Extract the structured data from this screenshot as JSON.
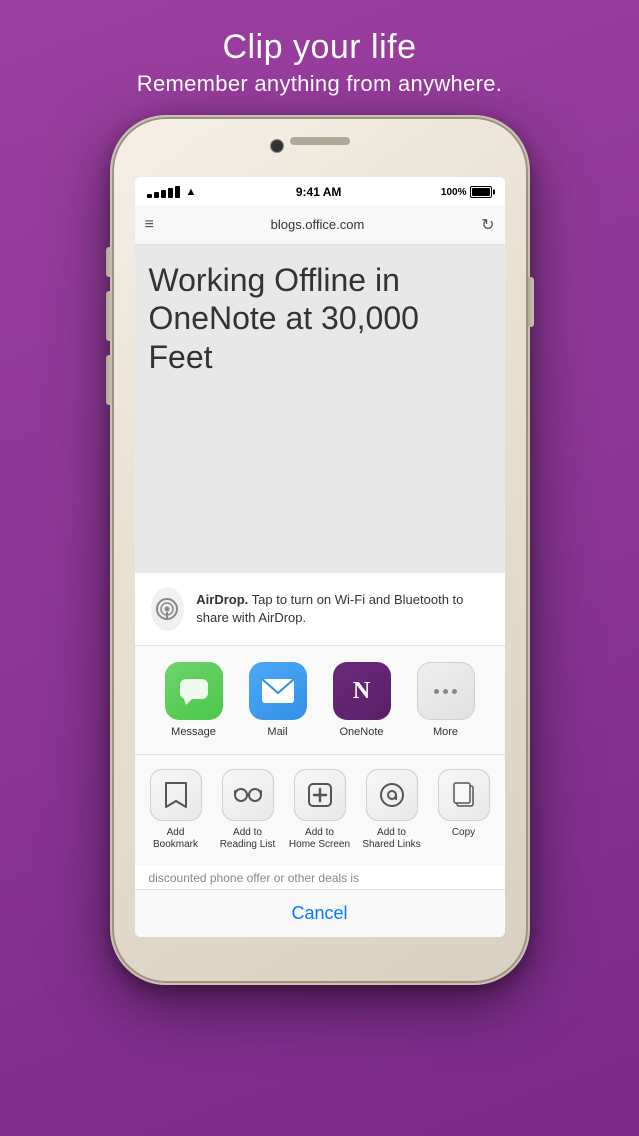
{
  "headline": {
    "line1": "Clip your life",
    "line2": "Remember anything from anywhere."
  },
  "status_bar": {
    "time": "9:41 AM",
    "battery_percent": "100%",
    "signal_label": "signal",
    "wifi_label": "wifi"
  },
  "nav_bar": {
    "url": "blogs.office.com",
    "menu_label": "menu",
    "refresh_label": "refresh"
  },
  "article": {
    "title": "Working Offline in OneNote at 30,000 Feet"
  },
  "airdrop": {
    "bold": "AirDrop.",
    "text": " Tap to turn on Wi-Fi and Bluetooth to share with AirDrop."
  },
  "apps": [
    {
      "name": "message",
      "label": "Message",
      "type": "message"
    },
    {
      "name": "mail",
      "label": "Mail",
      "type": "mail"
    },
    {
      "name": "onenote",
      "label": "OneNote",
      "type": "onenote"
    },
    {
      "name": "more",
      "label": "More",
      "type": "more"
    }
  ],
  "actions": [
    {
      "name": "add-bookmark",
      "label": "Add\nBookmark",
      "icon": "📖"
    },
    {
      "name": "reading-list",
      "label": "Add to\nReading List",
      "icon": "👓"
    },
    {
      "name": "home-screen",
      "label": "Add to\nHome Screen",
      "icon": "➕"
    },
    {
      "name": "shared-links",
      "label": "Add to\nShared Links",
      "icon": "@"
    },
    {
      "name": "copy",
      "label": "Copy",
      "icon": "📋"
    }
  ],
  "page_snippet": "discounted phone offer or other deals is",
  "cancel_label": "Cancel"
}
